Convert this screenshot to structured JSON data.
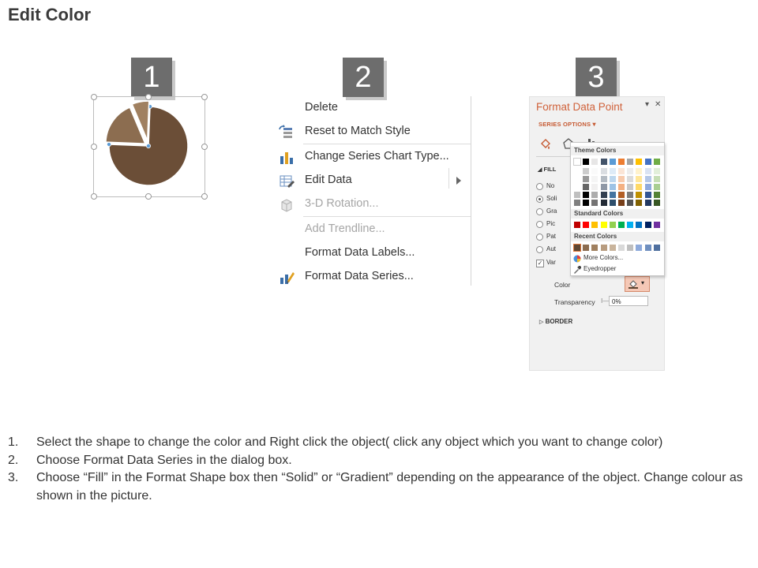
{
  "slide": {
    "title": "Edit Color"
  },
  "steps": [
    "1",
    "2",
    "3"
  ],
  "context_menu": {
    "items": [
      {
        "label": "Delete",
        "icon": "none",
        "disabled": false
      },
      {
        "label": "Reset to Match Style",
        "icon": "reset-style-icon",
        "disabled": false
      },
      {
        "label": "Change Series Chart Type...",
        "icon": "bar-chart-icon",
        "disabled": false
      },
      {
        "label": "Edit Data",
        "icon": "edit-data-icon",
        "disabled": false,
        "submenu": true
      },
      {
        "label": "3-D Rotation...",
        "icon": "cube-icon",
        "disabled": true
      },
      {
        "label": "Add Trendline...",
        "icon": "none",
        "disabled": true
      },
      {
        "label": "Format Data Labels...",
        "icon": "none",
        "disabled": false
      },
      {
        "label": "Format Data Series...",
        "icon": "format-series-icon",
        "disabled": false
      }
    ]
  },
  "format_pane": {
    "title": "Format Data Point",
    "dropdown_glyph": "▾",
    "close_glyph": "✕",
    "series_options": "SERIES OPTIONS",
    "fill_header": "FILL",
    "fill_options": [
      "No",
      "Soli",
      "Gra",
      "Pic",
      "Pat",
      "Aut"
    ],
    "vary_option": "Var",
    "color_label": "Color",
    "transparency_label": "Transparency",
    "transparency_value": "0%",
    "border_header": "BORDER",
    "accent_color": "#d0623b"
  },
  "color_picker": {
    "theme_colors_label": "Theme Colors",
    "standard_colors_label": "Standard Colors",
    "recent_colors_label": "Recent Colors",
    "more_colors": "More Colors...",
    "eyedropper": "Eyedropper",
    "theme_base": [
      "#ffffff",
      "#000000",
      "#e7e6e6",
      "#44546a",
      "#5b9bd5",
      "#ed7d31",
      "#a5a5a5",
      "#ffc000",
      "#4472c4",
      "#70ad47"
    ],
    "standard": [
      "#c00000",
      "#ff0000",
      "#ffc000",
      "#ffff00",
      "#92d050",
      "#00b050",
      "#00b0f0",
      "#0070c0",
      "#002060",
      "#7030a0"
    ],
    "recent": [
      "#5e4632",
      "#8b6b4e",
      "#a0805f",
      "#b89c7f",
      "#c9b49c",
      "#d9d9d9",
      "#bfbfbf",
      "#8eaadb",
      "#6f8fbf",
      "#4f6f9f"
    ]
  },
  "chart_data": {
    "type": "pie",
    "slice_colors": [
      "#6b4e37",
      "#8c6d50",
      "#a08060"
    ],
    "values": [
      75,
      18,
      7
    ]
  },
  "instructions": [
    {
      "num": "1.",
      "text": "Select the shape to change the color and Right click the object( click any object which you want to change color)"
    },
    {
      "num": "2.",
      "text": "Choose Format Data Series in the dialog box."
    },
    {
      "num": "3.",
      "text": "Choose “Fill” in the Format Shape box then “Solid” or “Gradient” depending on the appearance of the object. Change colour as shown in the picture."
    }
  ]
}
